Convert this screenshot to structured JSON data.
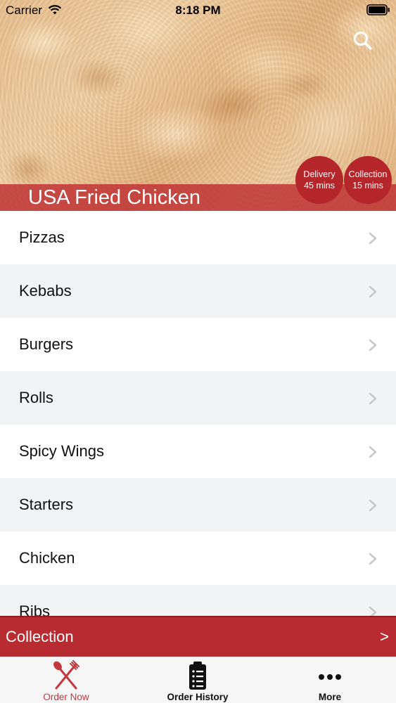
{
  "status_bar": {
    "carrier": "Carrier",
    "time": "8:18 PM",
    "icons": [
      "wifi-icon",
      "battery-icon"
    ]
  },
  "header": {
    "restaurant_name": "USA Fried Chicken",
    "search_icon": "search-icon",
    "delivery": {
      "label": "Delivery",
      "time": "45 mins"
    },
    "collection": {
      "label": "Collection",
      "time": "15 mins"
    }
  },
  "categories": [
    {
      "label": "Pizzas"
    },
    {
      "label": "Kebabs"
    },
    {
      "label": "Burgers"
    },
    {
      "label": "Rolls"
    },
    {
      "label": "Spicy Wings"
    },
    {
      "label": "Starters"
    },
    {
      "label": "Chicken"
    },
    {
      "label": "Ribs"
    }
  ],
  "collection_bar": {
    "label": "Collection",
    "arrow": ">"
  },
  "tab_bar": {
    "tabs": [
      {
        "label": "Order Now",
        "icon": "fork-knife-icon",
        "active": true
      },
      {
        "label": "Order History",
        "icon": "clipboard-list-icon",
        "active": false
      },
      {
        "label": "More",
        "icon": "more-dots-icon",
        "active": false
      }
    ]
  },
  "colors": {
    "brand_red": "#b82c31",
    "active_tab": "#c2383c",
    "alt_row": "#f1f3f5"
  }
}
